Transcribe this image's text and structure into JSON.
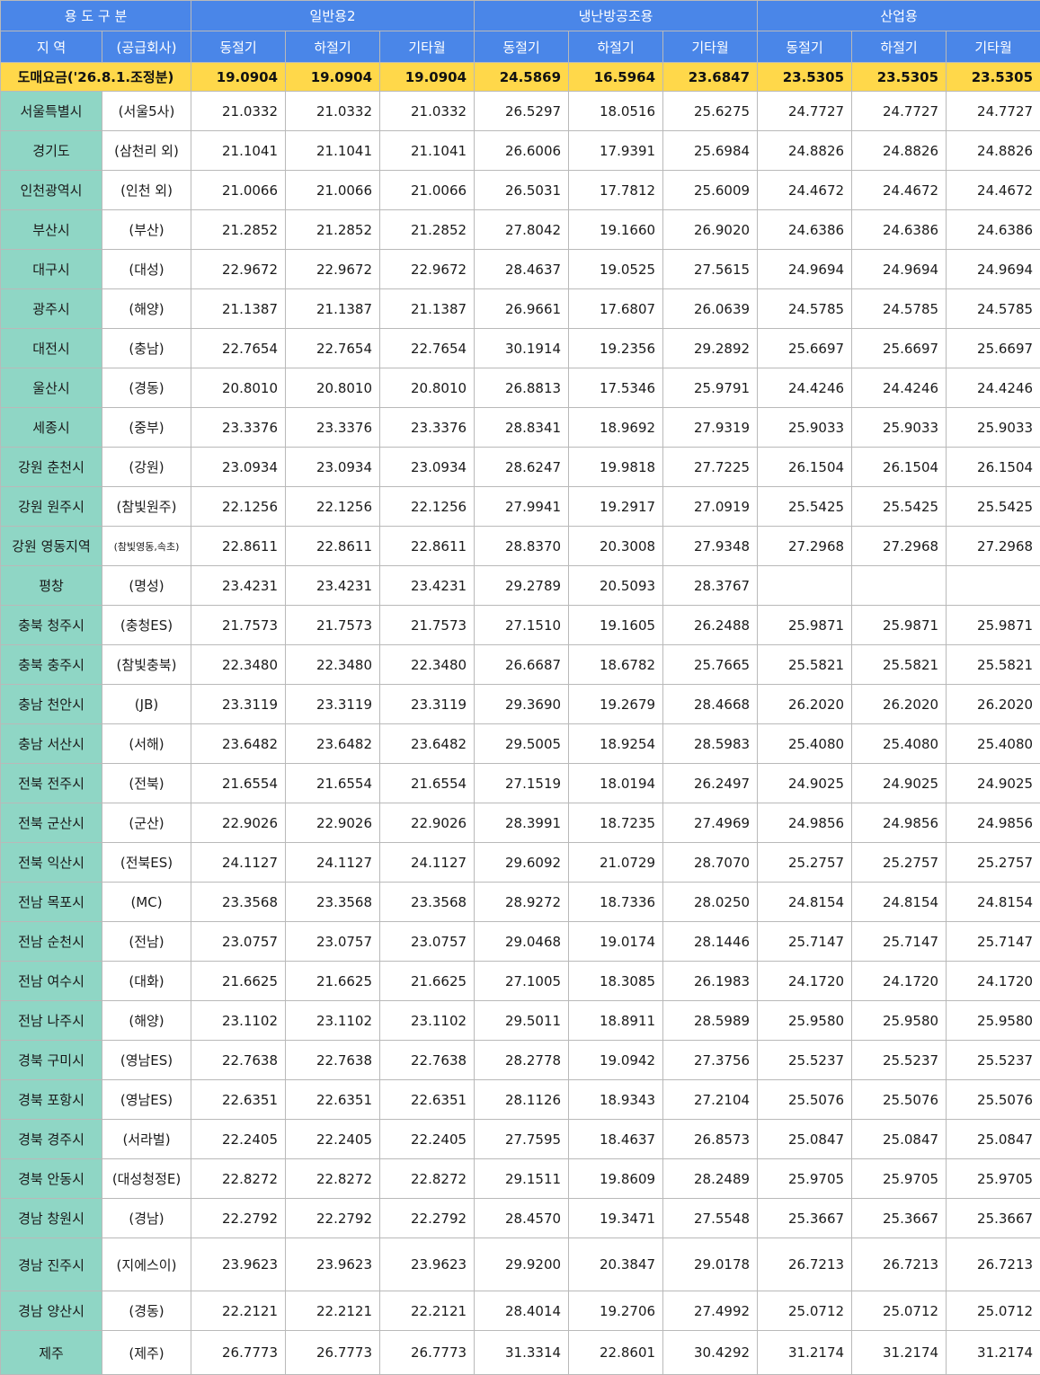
{
  "header": {
    "category": "용 도 구 분",
    "groups": [
      "일반용2",
      "냉난방공조용",
      "산업용"
    ],
    "region": "지 역",
    "company": "(공급회사)",
    "seasons": [
      "동절기",
      "하절기",
      "기타월"
    ]
  },
  "wholesale": {
    "label": "도매요금('26.8.1.조정분)",
    "values": [
      "19.0904",
      "19.0904",
      "19.0904",
      "24.5869",
      "16.5964",
      "23.6847",
      "23.5305",
      "23.5305",
      "23.5305"
    ]
  },
  "rows": [
    {
      "region": "서울특별시",
      "company": "(서울5사)",
      "values": [
        "21.0332",
        "21.0332",
        "21.0332",
        "26.5297",
        "18.0516",
        "25.6275",
        "24.7727",
        "24.7727",
        "24.7727"
      ]
    },
    {
      "region": "경기도",
      "company": "(삼천리 외)",
      "values": [
        "21.1041",
        "21.1041",
        "21.1041",
        "26.6006",
        "17.9391",
        "25.6984",
        "24.8826",
        "24.8826",
        "24.8826"
      ]
    },
    {
      "region": "인천광역시",
      "company": "(인천 외)",
      "values": [
        "21.0066",
        "21.0066",
        "21.0066",
        "26.5031",
        "17.7812",
        "25.6009",
        "24.4672",
        "24.4672",
        "24.4672"
      ]
    },
    {
      "region": "부산시",
      "company": "(부산)",
      "values": [
        "21.2852",
        "21.2852",
        "21.2852",
        "27.8042",
        "19.1660",
        "26.9020",
        "24.6386",
        "24.6386",
        "24.6386"
      ]
    },
    {
      "region": "대구시",
      "company": "(대성)",
      "values": [
        "22.9672",
        "22.9672",
        "22.9672",
        "28.4637",
        "19.0525",
        "27.5615",
        "24.9694",
        "24.9694",
        "24.9694"
      ]
    },
    {
      "region": "광주시",
      "company": "(해양)",
      "values": [
        "21.1387",
        "21.1387",
        "21.1387",
        "26.9661",
        "17.6807",
        "26.0639",
        "24.5785",
        "24.5785",
        "24.5785"
      ]
    },
    {
      "region": "대전시",
      "company": "(충남)",
      "values": [
        "22.7654",
        "22.7654",
        "22.7654",
        "30.1914",
        "19.2356",
        "29.2892",
        "25.6697",
        "25.6697",
        "25.6697"
      ]
    },
    {
      "region": "울산시",
      "company": "(경동)",
      "values": [
        "20.8010",
        "20.8010",
        "20.8010",
        "26.8813",
        "17.5346",
        "25.9791",
        "24.4246",
        "24.4246",
        "24.4246"
      ]
    },
    {
      "region": "세종시",
      "company": "(중부)",
      "values": [
        "23.3376",
        "23.3376",
        "23.3376",
        "28.8341",
        "18.9692",
        "27.9319",
        "25.9033",
        "25.9033",
        "25.9033"
      ]
    },
    {
      "region": "강원 춘천시",
      "company": "(강원)",
      "values": [
        "23.0934",
        "23.0934",
        "23.0934",
        "28.6247",
        "19.9818",
        "27.7225",
        "26.1504",
        "26.1504",
        "26.1504"
      ]
    },
    {
      "region": "강원 원주시",
      "company": "(참빛원주)",
      "values": [
        "22.1256",
        "22.1256",
        "22.1256",
        "27.9941",
        "19.2917",
        "27.0919",
        "25.5425",
        "25.5425",
        "25.5425"
      ]
    },
    {
      "region": "강원 영동지역",
      "company": "(참빛영동,속초)",
      "small": true,
      "values": [
        "22.8611",
        "22.8611",
        "22.8611",
        "28.8370",
        "20.3008",
        "27.9348",
        "27.2968",
        "27.2968",
        "27.2968"
      ]
    },
    {
      "region": "평창",
      "company": "(명성)",
      "values": [
        "23.4231",
        "23.4231",
        "23.4231",
        "29.2789",
        "20.5093",
        "28.3767",
        "",
        "",
        ""
      ]
    },
    {
      "region": "충북 청주시",
      "company": "(충청ES)",
      "values": [
        "21.7573",
        "21.7573",
        "21.7573",
        "27.1510",
        "19.1605",
        "26.2488",
        "25.9871",
        "25.9871",
        "25.9871"
      ]
    },
    {
      "region": "충북 충주시",
      "company": "(참빛충북)",
      "values": [
        "22.3480",
        "22.3480",
        "22.3480",
        "26.6687",
        "18.6782",
        "25.7665",
        "25.5821",
        "25.5821",
        "25.5821"
      ]
    },
    {
      "region": "충남 천안시",
      "company": "(JB)",
      "values": [
        "23.3119",
        "23.3119",
        "23.3119",
        "29.3690",
        "19.2679",
        "28.4668",
        "26.2020",
        "26.2020",
        "26.2020"
      ]
    },
    {
      "region": "충남 서산시",
      "company": "(서해)",
      "values": [
        "23.6482",
        "23.6482",
        "23.6482",
        "29.5005",
        "18.9254",
        "28.5983",
        "25.4080",
        "25.4080",
        "25.4080"
      ]
    },
    {
      "region": "전북 전주시",
      "company": "(전북)",
      "values": [
        "21.6554",
        "21.6554",
        "21.6554",
        "27.1519",
        "18.0194",
        "26.2497",
        "24.9025",
        "24.9025",
        "24.9025"
      ]
    },
    {
      "region": "전북 군산시",
      "company": "(군산)",
      "values": [
        "22.9026",
        "22.9026",
        "22.9026",
        "28.3991",
        "18.7235",
        "27.4969",
        "24.9856",
        "24.9856",
        "24.9856"
      ]
    },
    {
      "region": "전북 익산시",
      "company": "(전북ES)",
      "values": [
        "24.1127",
        "24.1127",
        "24.1127",
        "29.6092",
        "21.0729",
        "28.7070",
        "25.2757",
        "25.2757",
        "25.2757"
      ]
    },
    {
      "region": "전남 목포시",
      "company": "(MC)",
      "values": [
        "23.3568",
        "23.3568",
        "23.3568",
        "28.9272",
        "18.7336",
        "28.0250",
        "24.8154",
        "24.8154",
        "24.8154"
      ]
    },
    {
      "region": "전남 순천시",
      "company": "(전남)",
      "values": [
        "23.0757",
        "23.0757",
        "23.0757",
        "29.0468",
        "19.0174",
        "28.1446",
        "25.7147",
        "25.7147",
        "25.7147"
      ]
    },
    {
      "region": "전남 여수시",
      "company": "(대화)",
      "values": [
        "21.6625",
        "21.6625",
        "21.6625",
        "27.1005",
        "18.3085",
        "26.1983",
        "24.1720",
        "24.1720",
        "24.1720"
      ]
    },
    {
      "region": "전남 나주시",
      "company": "(해양)",
      "values": [
        "23.1102",
        "23.1102",
        "23.1102",
        "29.5011",
        "18.8911",
        "28.5989",
        "25.9580",
        "25.9580",
        "25.9580"
      ]
    },
    {
      "region": "경북 구미시",
      "company": "(영남ES)",
      "values": [
        "22.7638",
        "22.7638",
        "22.7638",
        "28.2778",
        "19.0942",
        "27.3756",
        "25.5237",
        "25.5237",
        "25.5237"
      ]
    },
    {
      "region": "경북 포항시",
      "company": "(영남ES)",
      "values": [
        "22.6351",
        "22.6351",
        "22.6351",
        "28.1126",
        "18.9343",
        "27.2104",
        "25.5076",
        "25.5076",
        "25.5076"
      ]
    },
    {
      "region": "경북 경주시",
      "company": "(서라벌)",
      "values": [
        "22.2405",
        "22.2405",
        "22.2405",
        "27.7595",
        "18.4637",
        "26.8573",
        "25.0847",
        "25.0847",
        "25.0847"
      ]
    },
    {
      "region": "경북 안동시",
      "company": "(대성청정E)",
      "values": [
        "22.8272",
        "22.8272",
        "22.8272",
        "29.1511",
        "19.8609",
        "28.2489",
        "25.9705",
        "25.9705",
        "25.9705"
      ]
    },
    {
      "region": "경남 창원시",
      "company": "(경남)",
      "values": [
        "22.2792",
        "22.2792",
        "22.2792",
        "28.4570",
        "19.3471",
        "27.5548",
        "25.3667",
        "25.3667",
        "25.3667"
      ]
    },
    {
      "region": "경남 진주시",
      "company": "(지에스이)",
      "tall": true,
      "values": [
        "23.9623",
        "23.9623",
        "23.9623",
        "29.9200",
        "20.3847",
        "29.0178",
        "26.7213",
        "26.7213",
        "26.7213"
      ]
    },
    {
      "region": "경남 양산시",
      "company": "(경동)",
      "values": [
        "22.2121",
        "22.2121",
        "22.2121",
        "28.4014",
        "19.2706",
        "27.4992",
        "25.0712",
        "25.0712",
        "25.0712"
      ]
    },
    {
      "region": "제주",
      "company": "(제주)",
      "mid": true,
      "values": [
        "26.7773",
        "26.7773",
        "26.7773",
        "31.3314",
        "22.8601",
        "30.4292",
        "31.2174",
        "31.2174",
        "31.2174"
      ]
    }
  ]
}
